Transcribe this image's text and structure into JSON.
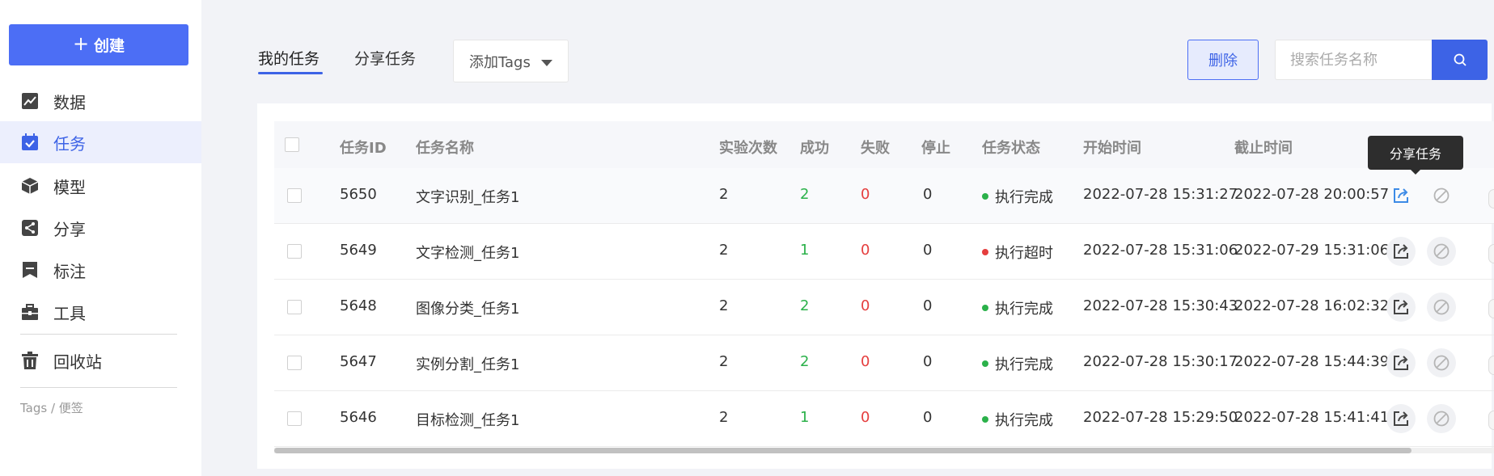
{
  "sidebar": {
    "create_label": "创建",
    "items": [
      {
        "label": "数据",
        "icon": "chart-icon",
        "active": false
      },
      {
        "label": "任务",
        "icon": "calendar-check-icon",
        "active": true
      },
      {
        "label": "模型",
        "icon": "cube-icon",
        "active": false
      },
      {
        "label": "分享",
        "icon": "share-icon",
        "active": false
      },
      {
        "label": "标注",
        "icon": "bookmark-icon",
        "active": false
      },
      {
        "label": "工具",
        "icon": "toolbox-icon",
        "active": false
      },
      {
        "label": "回收站",
        "icon": "trash-icon",
        "active": false
      }
    ],
    "tags_label": "Tags / 便签"
  },
  "toolbar": {
    "tabs": [
      {
        "label": "我的任务",
        "active": true
      },
      {
        "label": "分享任务",
        "active": false
      }
    ],
    "tags_select": "添加Tags",
    "delete_label": "删除",
    "search_placeholder": "搜索任务名称"
  },
  "table": {
    "headers": [
      "任务ID",
      "任务名称",
      "实验次数",
      "成功",
      "失败",
      "停止",
      "任务状态",
      "开始时间",
      "截止时间"
    ],
    "rows": [
      {
        "id": "5650",
        "name": "文字识别_任务1",
        "runs": "2",
        "success": "2",
        "fail": "0",
        "stop": "0",
        "status": "执行完成",
        "status_color": "#2bb14a",
        "start": "2022-07-28 15:31:27",
        "end": "2022-07-28 20:00:57"
      },
      {
        "id": "5649",
        "name": "文字检测_任务1",
        "runs": "2",
        "success": "1",
        "fail": "0",
        "stop": "0",
        "status": "执行超时",
        "status_color": "#e53e3e",
        "start": "2022-07-28 15:31:06",
        "end": "2022-07-29 15:31:06"
      },
      {
        "id": "5648",
        "name": "图像分类_任务1",
        "runs": "2",
        "success": "2",
        "fail": "0",
        "stop": "0",
        "status": "执行完成",
        "status_color": "#2bb14a",
        "start": "2022-07-28 15:30:43",
        "end": "2022-07-28 16:02:32"
      },
      {
        "id": "5647",
        "name": "实例分割_任务1",
        "runs": "2",
        "success": "2",
        "fail": "0",
        "stop": "0",
        "status": "执行完成",
        "status_color": "#2bb14a",
        "start": "2022-07-28 15:30:17",
        "end": "2022-07-28 15:44:39"
      },
      {
        "id": "5646",
        "name": "目标检测_任务1",
        "runs": "2",
        "success": "1",
        "fail": "0",
        "stop": "0",
        "status": "执行完成",
        "status_color": "#2bb14a",
        "start": "2022-07-28 15:29:50",
        "end": "2022-07-28 15:41:41"
      }
    ]
  },
  "tooltip": "分享任务",
  "colors": {
    "accent": "#3d63e6",
    "success": "#2bb14a",
    "danger": "#e53e3e"
  }
}
